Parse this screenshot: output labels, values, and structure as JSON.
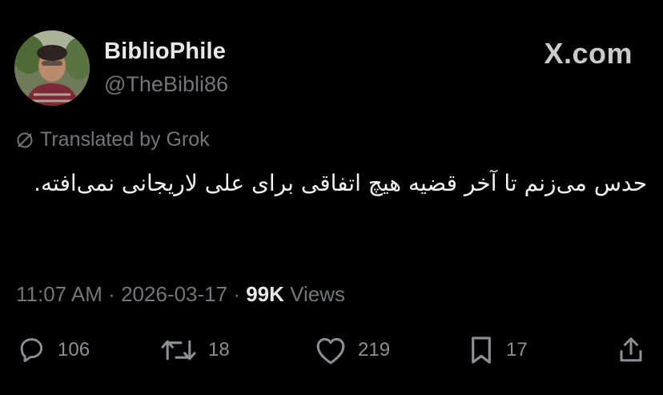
{
  "author": {
    "display_name": "BiblioPhile",
    "handle": "@TheBibli86",
    "avatar_icon": "profile-photo"
  },
  "brand": {
    "label": "X.com"
  },
  "translation": {
    "label": "Translated by Grok",
    "icon": "translate-slash-icon"
  },
  "tweet": {
    "text": "حدس می‌زنم تا آخر قضیه هیچ اتفاقی برای علی لاریجانی نمی‌افته."
  },
  "meta": {
    "time": "11:07 AM",
    "separator": "·",
    "date": "2026-03-17",
    "views_count": "99K",
    "views_label": "Views"
  },
  "actions": {
    "replies": "106",
    "reposts": "18",
    "likes": "219",
    "bookmarks": "17"
  },
  "colors": {
    "background": "#000000",
    "primary_text": "#e7e9ea",
    "secondary_text": "#71767b",
    "icon": "#8b9096"
  }
}
